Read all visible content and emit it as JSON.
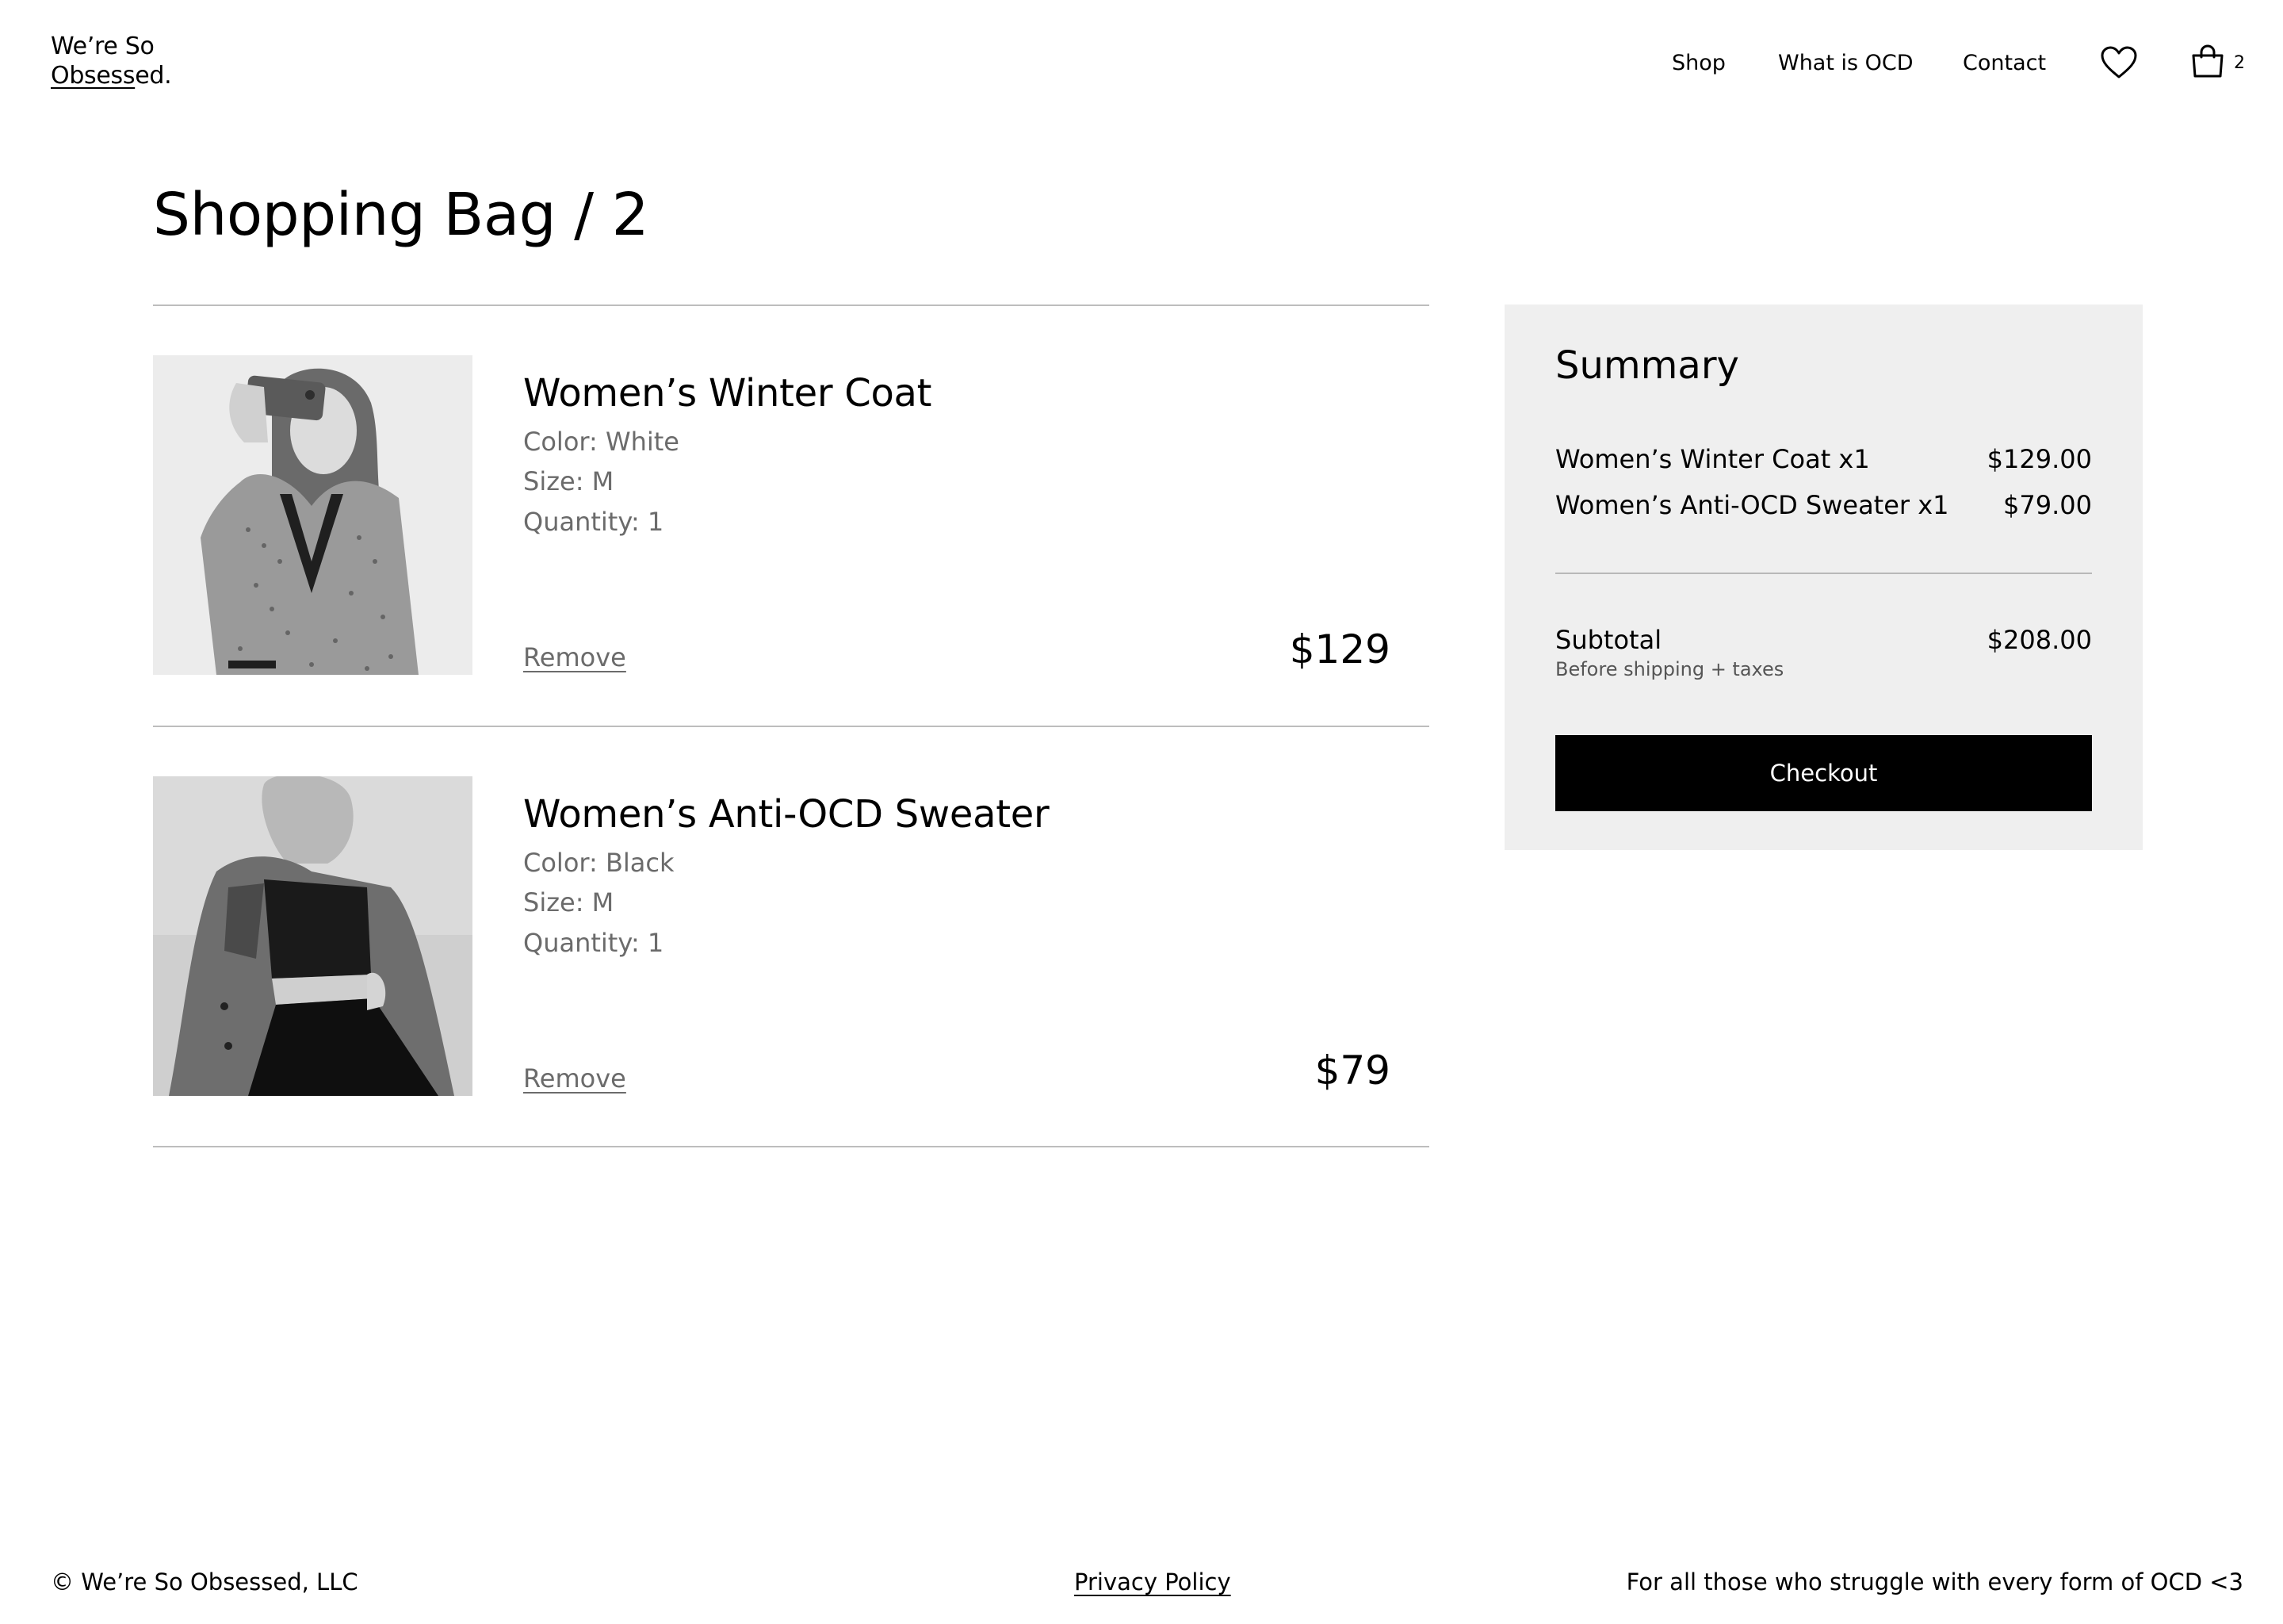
{
  "header": {
    "logo_line1": "We’re So",
    "logo_underlined": "Obsess",
    "logo_rest": "ed.",
    "nav": {
      "shop": "Shop",
      "what_is_ocd": "What is OCD",
      "contact": "Contact"
    },
    "wishlist_icon": "heart-icon",
    "bag_icon": "shopping-bag-icon",
    "bag_count": "2"
  },
  "page": {
    "title": "Shopping Bag / 2"
  },
  "cart": {
    "items": [
      {
        "name": "Women’s Winter Coat",
        "color": "Color: White",
        "size": "Size: M",
        "quantity": "Quantity: 1",
        "remove_label": "Remove",
        "price": "$129"
      },
      {
        "name": "Women’s Anti-OCD Sweater",
        "color": "Color: Black",
        "size": "Size: M",
        "quantity": "Quantity: 1",
        "remove_label": "Remove",
        "price": "$79"
      }
    ]
  },
  "summary": {
    "title": "Summary",
    "lines": [
      {
        "label": "Women’s Winter Coat x1",
        "amount": "$129.00"
      },
      {
        "label": "Women’s Anti-OCD Sweater x1",
        "amount": "$79.00"
      }
    ],
    "subtotal_label": "Subtotal",
    "subtotal_amount": "$208.00",
    "subtotal_note": "Before shipping + taxes",
    "checkout_label": "Checkout"
  },
  "footer": {
    "copyright": "© We’re So Obsessed, LLC",
    "privacy": "Privacy Policy",
    "tagline": "For all those who struggle with every form of OCD <3"
  },
  "colors": {
    "text": "#000000",
    "muted": "#6b6b6b",
    "summary_bg": "#efefef",
    "checkout_bg": "#000000",
    "checkout_text": "#ffffff"
  }
}
